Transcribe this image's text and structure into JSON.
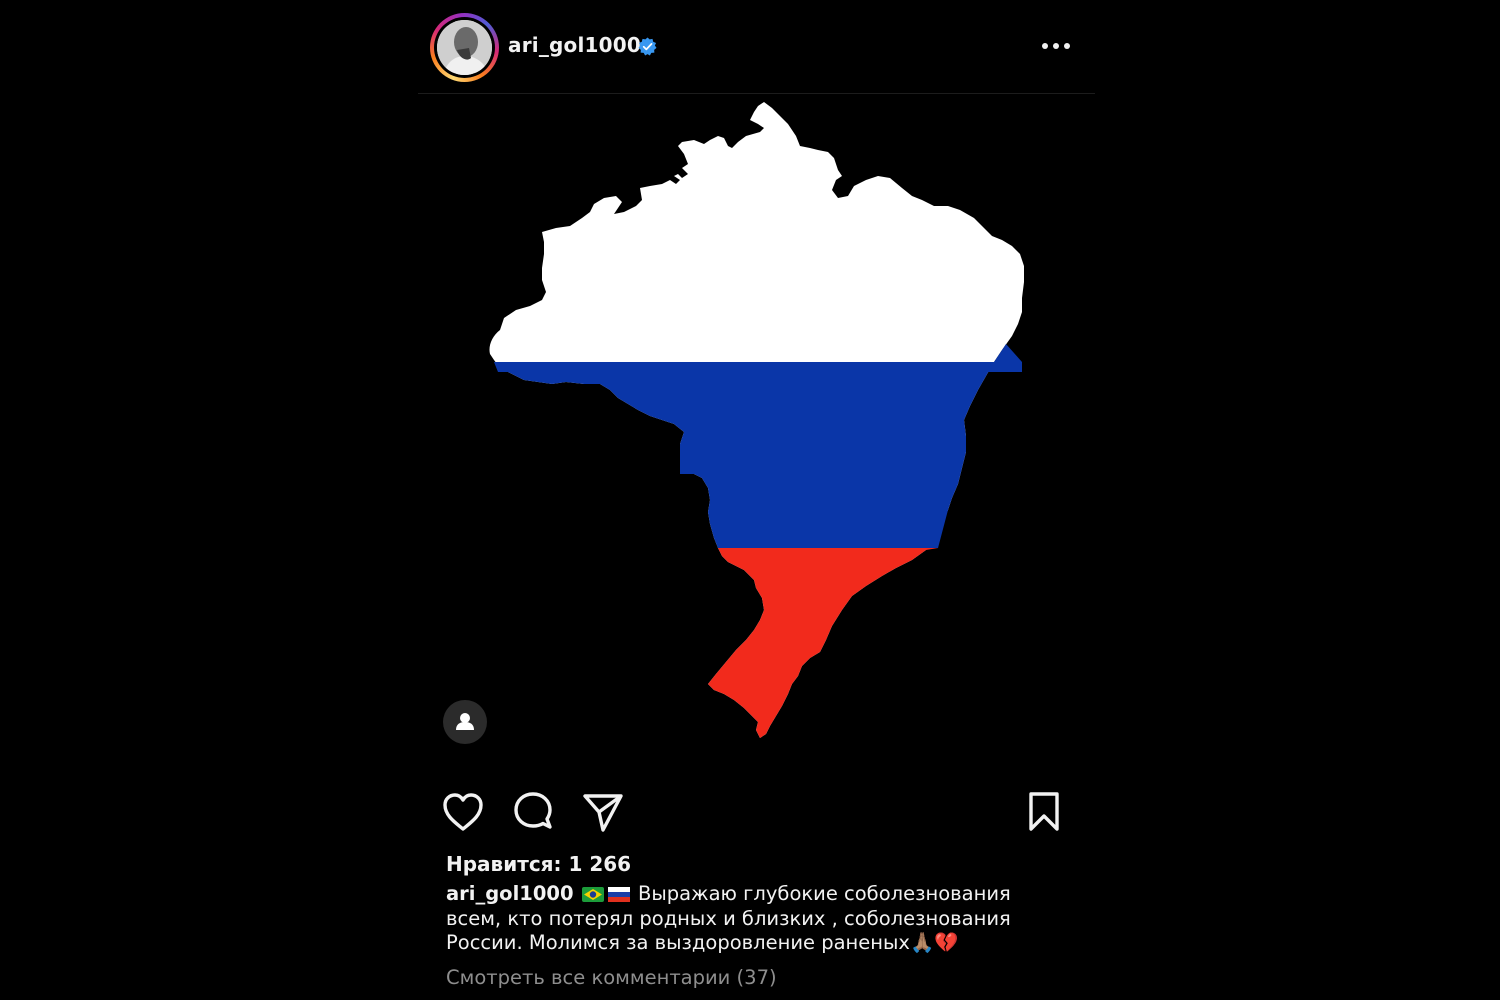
{
  "post": {
    "header": {
      "username": "ari_gol1000",
      "verified": true
    },
    "image": {
      "description_icons": [
        "brazil-map-icon"
      ],
      "flag_colors": {
        "white": "#ffffff",
        "blue": "#0a36a8",
        "red": "#f22a1c"
      }
    },
    "likes_text": "Нравится: 1 266",
    "caption": {
      "username": "ari_gol1000",
      "emoji_flags": [
        "brazil-flag-icon",
        "russia-flag-icon"
      ],
      "line1": "Выражаю глубокие соболезнования",
      "line2": "всем, кто потерял родных и близких , соболезнования",
      "line3": "России.  Молимся за выздоровление раненых",
      "end_emojis": "🙏🏽💔"
    },
    "view_comments": "Смотреть все комментарии (37)",
    "colors": {
      "background": "#000000",
      "text": "#f2f2f2",
      "muted": "#8e8e8e",
      "verified": "#3897f0"
    }
  }
}
